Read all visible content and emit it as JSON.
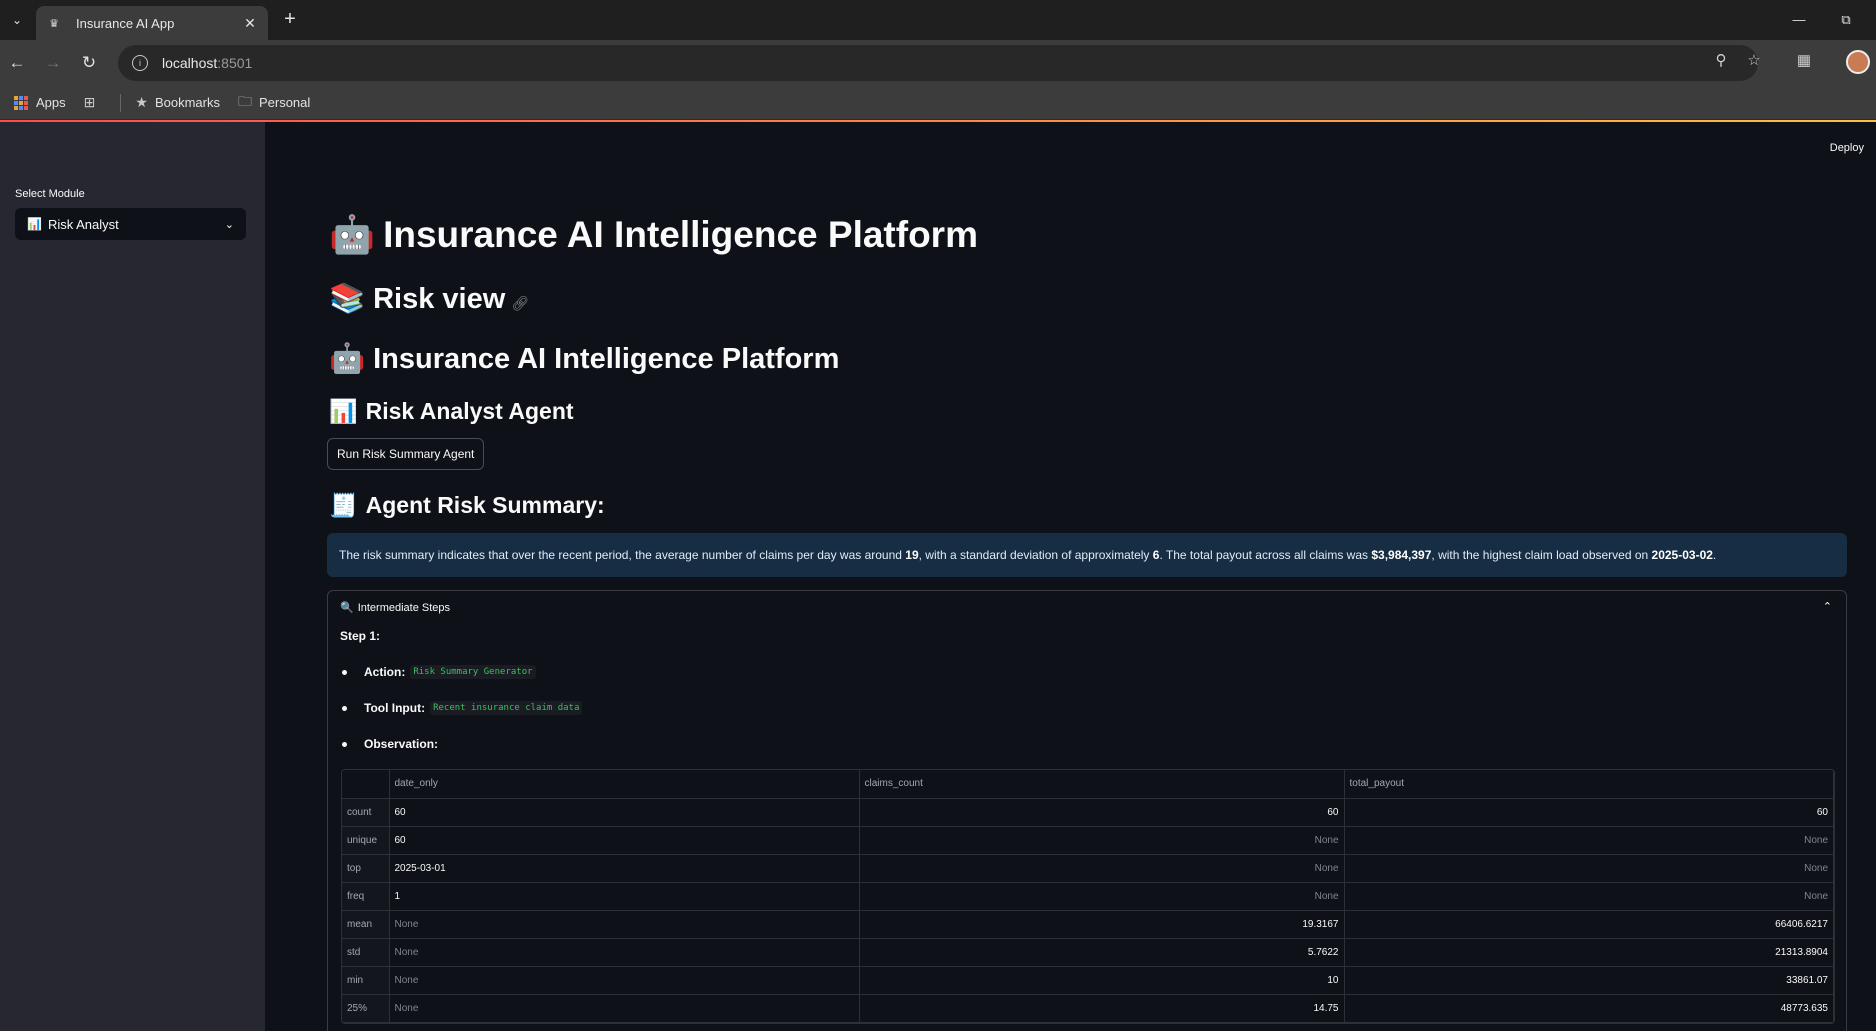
{
  "browser": {
    "tab_title": "Insurance AI App",
    "url_host": "localhost",
    "url_port": ":8501",
    "bookmarks": [
      {
        "label": "Apps"
      },
      {
        "label": "Bookmarks"
      },
      {
        "label": "Personal"
      }
    ]
  },
  "sidebar": {
    "label": "Select Module",
    "selected_module": "Risk Analyst",
    "selected_module_icon": "bar-chart-emoji"
  },
  "header": {
    "deploy_label": "Deploy"
  },
  "main": {
    "title": "Insurance AI Intelligence Platform",
    "risk_view_heading": "Risk view",
    "title_repeat": "Insurance AI Intelligence Platform",
    "agent_heading": "Risk Analyst Agent",
    "run_button": "Run Risk Summary Agent",
    "summary_heading": "Agent Risk Summary:",
    "summary": {
      "part1": "The risk summary indicates that over the recent period, the average number of claims per day was around ",
      "avg_claims": "19",
      "part2": ", with a standard deviation of approximately ",
      "std": "6",
      "part3": ". The total payout across all claims was ",
      "total_payout": "$3,984,397",
      "part4": ", with the highest claim load observed on ",
      "peak_date": "2025-03-02",
      "part5": "."
    },
    "expander": {
      "label": "Intermediate Steps",
      "step_title": "Step 1:",
      "action_label": "Action:",
      "action_value": "Risk Summary Generator",
      "tool_input_label": "Tool Input:",
      "tool_input_value": "Recent insurance claim data",
      "observation_label": "Observation:"
    },
    "table": {
      "columns": [
        "",
        "date_only",
        "claims_count",
        "total_payout"
      ],
      "rows": [
        [
          "count",
          "60",
          "60",
          "60"
        ],
        [
          "unique",
          "60",
          "None",
          "None"
        ],
        [
          "top",
          "2025-03-01",
          "None",
          "None"
        ],
        [
          "freq",
          "1",
          "None",
          "None"
        ],
        [
          "mean",
          "None",
          "19.3167",
          "66406.6217"
        ],
        [
          "std",
          "None",
          "5.7622",
          "21313.8904"
        ],
        [
          "min",
          "None",
          "10",
          "33861.07"
        ],
        [
          "25%",
          "None",
          "14.75",
          "48773.635"
        ]
      ]
    }
  }
}
